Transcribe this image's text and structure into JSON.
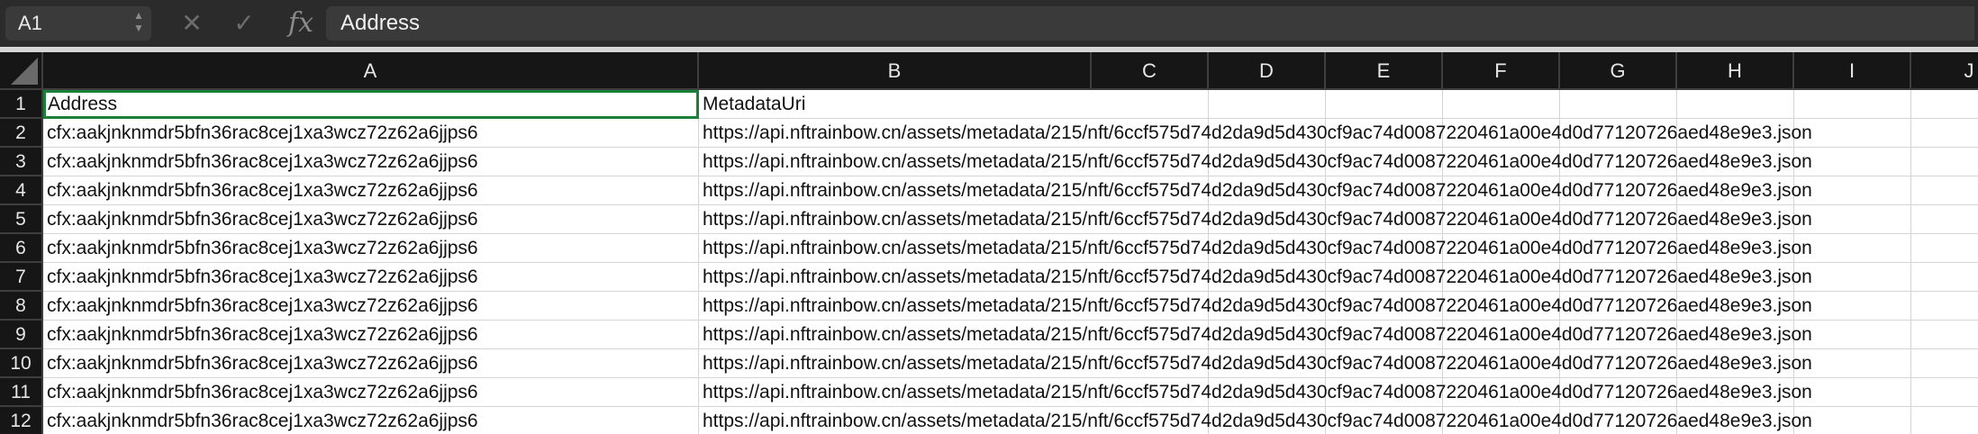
{
  "formula_bar": {
    "name_box": "A1",
    "name_box_stepper_up": "▲",
    "name_box_stepper_down": "▼",
    "cancel_icon": "✕",
    "confirm_icon": "✓",
    "fx_label": "fx",
    "formula_value": "Address"
  },
  "sheet": {
    "columns": [
      "A",
      "B",
      "C",
      "D",
      "E",
      "F",
      "G",
      "H",
      "I",
      "J"
    ],
    "rows": [
      {
        "num": "1",
        "a": "Address",
        "b": "MetadataUri"
      },
      {
        "num": "2",
        "a": "cfx:aakjnknmdr5bfn36rac8cej1xa3wcz72z62a6jjps6",
        "b": "https://api.nftrainbow.cn/assets/metadata/215/nft/6ccf575d74d2da9d5d430cf9ac74d0087220461a00e4d0d77120726aed48e9e3.json"
      },
      {
        "num": "3",
        "a": "cfx:aakjnknmdr5bfn36rac8cej1xa3wcz72z62a6jjps6",
        "b": "https://api.nftrainbow.cn/assets/metadata/215/nft/6ccf575d74d2da9d5d430cf9ac74d0087220461a00e4d0d77120726aed48e9e3.json"
      },
      {
        "num": "4",
        "a": "cfx:aakjnknmdr5bfn36rac8cej1xa3wcz72z62a6jjps6",
        "b": "https://api.nftrainbow.cn/assets/metadata/215/nft/6ccf575d74d2da9d5d430cf9ac74d0087220461a00e4d0d77120726aed48e9e3.json"
      },
      {
        "num": "5",
        "a": "cfx:aakjnknmdr5bfn36rac8cej1xa3wcz72z62a6jjps6",
        "b": "https://api.nftrainbow.cn/assets/metadata/215/nft/6ccf575d74d2da9d5d430cf9ac74d0087220461a00e4d0d77120726aed48e9e3.json"
      },
      {
        "num": "6",
        "a": "cfx:aakjnknmdr5bfn36rac8cej1xa3wcz72z62a6jjps6",
        "b": "https://api.nftrainbow.cn/assets/metadata/215/nft/6ccf575d74d2da9d5d430cf9ac74d0087220461a00e4d0d77120726aed48e9e3.json"
      },
      {
        "num": "7",
        "a": "cfx:aakjnknmdr5bfn36rac8cej1xa3wcz72z62a6jjps6",
        "b": "https://api.nftrainbow.cn/assets/metadata/215/nft/6ccf575d74d2da9d5d430cf9ac74d0087220461a00e4d0d77120726aed48e9e3.json"
      },
      {
        "num": "8",
        "a": "cfx:aakjnknmdr5bfn36rac8cej1xa3wcz72z62a6jjps6",
        "b": "https://api.nftrainbow.cn/assets/metadata/215/nft/6ccf575d74d2da9d5d430cf9ac74d0087220461a00e4d0d77120726aed48e9e3.json"
      },
      {
        "num": "9",
        "a": "cfx:aakjnknmdr5bfn36rac8cej1xa3wcz72z62a6jjps6",
        "b": "https://api.nftrainbow.cn/assets/metadata/215/nft/6ccf575d74d2da9d5d430cf9ac74d0087220461a00e4d0d77120726aed48e9e3.json"
      },
      {
        "num": "10",
        "a": "cfx:aakjnknmdr5bfn36rac8cej1xa3wcz72z62a6jjps6",
        "b": "https://api.nftrainbow.cn/assets/metadata/215/nft/6ccf575d74d2da9d5d430cf9ac74d0087220461a00e4d0d77120726aed48e9e3.json"
      },
      {
        "num": "11",
        "a": "cfx:aakjnknmdr5bfn36rac8cej1xa3wcz72z62a6jjps6",
        "b": "https://api.nftrainbow.cn/assets/metadata/215/nft/6ccf575d74d2da9d5d430cf9ac74d0087220461a00e4d0d77120726aed48e9e3.json"
      },
      {
        "num": "12",
        "a": "cfx:aakjnknmdr5bfn36rac8cej1xa3wcz72z62a6jjps6",
        "b": "https://api.nftrainbow.cn/assets/metadata/215/nft/6ccf575d74d2da9d5d430cf9ac74d0087220461a00e4d0d77120726aed48e9e3.json"
      }
    ],
    "selected_cell": "A1",
    "colors": {
      "header_bg": "#161616",
      "selection": "#1a7f37",
      "gridline": "#d4d4d4"
    }
  }
}
